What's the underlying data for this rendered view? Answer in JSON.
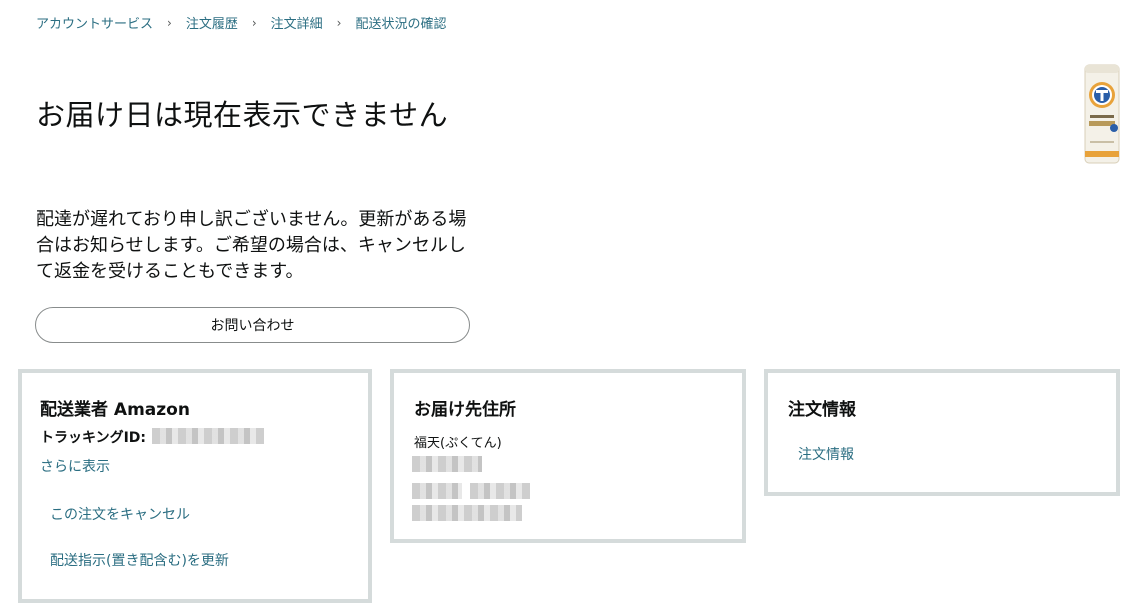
{
  "breadcrumb": {
    "items": [
      "アカウントサービス",
      "注文履歴",
      "注文詳細",
      "配送状況の確認"
    ],
    "separator": "›"
  },
  "title": "お届け日は現在表示できません",
  "message": "配達が遅れており申し訳ございません。更新がある場合はお知らせします。ご希望の場合は、キャンセルして返金を受けることもできます。",
  "contact_button": "お問い合わせ",
  "carrier": {
    "heading": "配送業者 Amazon",
    "tracking_label": "トラッキングID:",
    "show_more": "さらに表示",
    "cancel_link": "この注文をキャンセル",
    "update_link": "配送指示(置き配含む)を更新"
  },
  "address": {
    "heading": "お届け先住所",
    "name": "福天(ぷくてん)"
  },
  "order": {
    "heading": "注文情報",
    "link": "注文情報"
  },
  "colors": {
    "link": "#2b6e82",
    "card_border": "#d5dbdb",
    "text": "#0f1111"
  }
}
